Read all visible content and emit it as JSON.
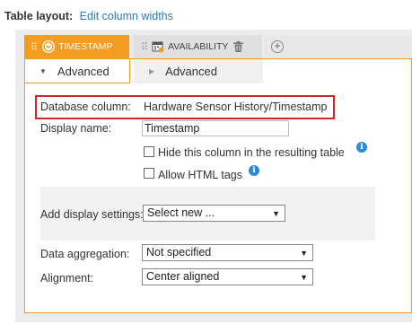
{
  "header": {
    "label": "Table layout:",
    "link": "Edit column widths"
  },
  "tabs": {
    "timestamp": {
      "label": "TIMESTAMP",
      "sub_label": "Advanced"
    },
    "availability": {
      "label": "AVAILABILITY",
      "sub_label": "Advanced"
    }
  },
  "form": {
    "database_column": {
      "label": "Database column:",
      "value": "Hardware Sensor History/Timestamp"
    },
    "display_name": {
      "label": "Display name:",
      "value": "Timestamp"
    },
    "hide_column": {
      "label": "Hide this column in the resulting table"
    },
    "allow_html": {
      "label": "Allow HTML tags"
    },
    "display_settings": {
      "label": "Add display settings:",
      "value": "Select new ..."
    },
    "data_aggregation": {
      "label": "Data aggregation:",
      "value": "Not specified"
    },
    "alignment": {
      "label": "Alignment:",
      "value": "Center aligned"
    }
  },
  "colors": {
    "accent": "#f39c1f",
    "link": "#2a7ab0",
    "highlight": "#d0262a",
    "info": "#2a8ad6"
  },
  "icons": {
    "timestamp_tab": "clock-icon",
    "availability_tab": "calendar-icon",
    "delete": "trash-icon",
    "add": "plus-circle-icon",
    "drag": "drag-handle-icon",
    "help": "info-icon"
  }
}
